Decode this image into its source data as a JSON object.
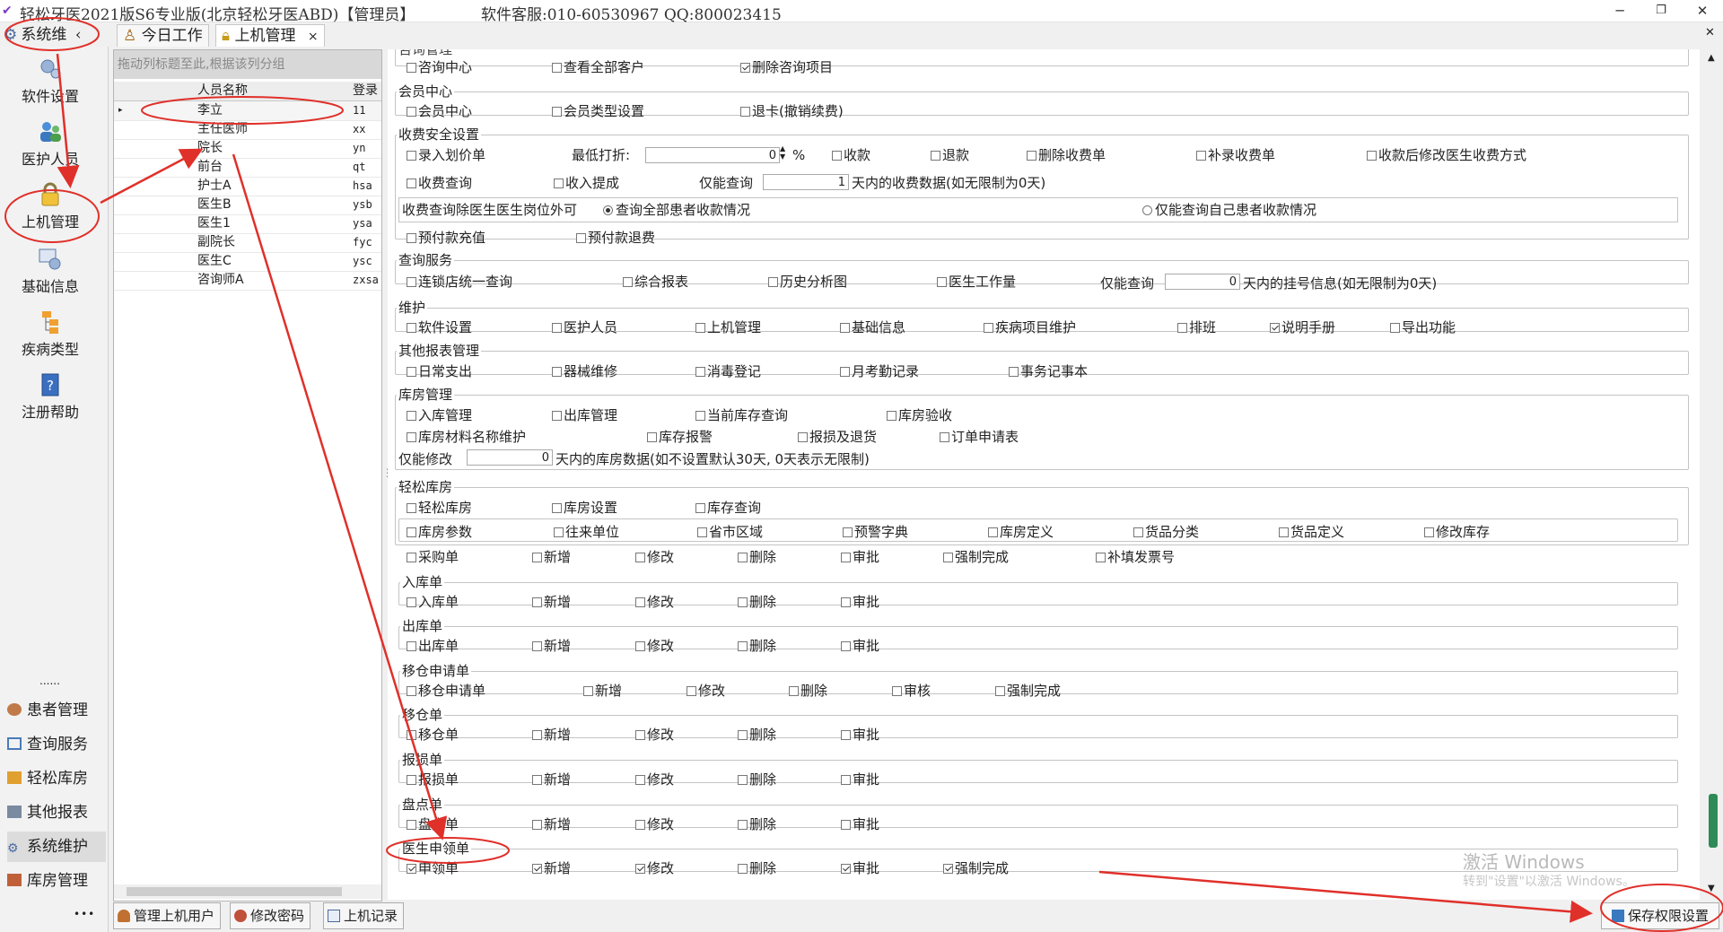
{
  "title": {
    "app": "轻松牙医2021版S6专业版(北京轻松牙医ABD)【管理员】",
    "service": "软件客服:010-60530967 QQ:800023415"
  },
  "window_buttons": {
    "minimize": "─",
    "restore": "❐",
    "close": "✕"
  },
  "sidebar_header": "系统维",
  "tabs": [
    {
      "label": "今日工作"
    },
    {
      "label": "上机管理",
      "close": "×"
    }
  ],
  "left_nav": {
    "big_items": [
      {
        "label": "软件设置"
      },
      {
        "label": "医护人员"
      },
      {
        "label": "上机管理"
      },
      {
        "label": "基础信息"
      },
      {
        "label": "疾病类型"
      },
      {
        "label": "注册帮助"
      }
    ],
    "dots": "......",
    "small_items": [
      {
        "label": "患者管理"
      },
      {
        "label": "查询服务"
      },
      {
        "label": "轻松库房"
      },
      {
        "label": "其他报表"
      },
      {
        "label": "系统维护"
      },
      {
        "label": "库房管理"
      }
    ],
    "more": "•••"
  },
  "user_grid": {
    "group_hint": "拖动列标题至此,根据该列分组",
    "columns": [
      "人员名称",
      "登录"
    ],
    "rows": [
      {
        "name": "李立",
        "login": "11",
        "checked": true
      },
      {
        "name": "主任医师",
        "login": "xx",
        "checked": false
      },
      {
        "name": "院长",
        "login": "yn",
        "checked": false
      },
      {
        "name": "前台",
        "login": "qt",
        "checked": false
      },
      {
        "name": "护士A",
        "login": "hsa",
        "checked": false
      },
      {
        "name": "医生B",
        "login": "ysb",
        "checked": false
      },
      {
        "name": "医生1",
        "login": "ysa",
        "checked": false
      },
      {
        "name": "副院长",
        "login": "fyc",
        "checked": false
      },
      {
        "name": "医生C",
        "login": "ysc",
        "checked": false
      },
      {
        "name": "咨询师A",
        "login": "zxsa",
        "checked": false
      }
    ]
  },
  "bottom_buttons": {
    "manage_users": "管理上机用户",
    "change_password": "修改密码",
    "login_records": "上机记录",
    "save": "保存权限设置"
  },
  "watermark": {
    "line1": "激活 Windows",
    "line2": "转到\"设置\"以激活 Windows。"
  },
  "permissions": {
    "consult": {
      "title": "咨询管理",
      "items": [
        {
          "label": "咨询中心",
          "on": false
        },
        {
          "label": "查看全部客户",
          "on": false
        },
        {
          "label": "删除咨询项目",
          "on": true
        }
      ]
    },
    "member": {
      "title": "会员中心",
      "items": [
        {
          "label": "会员中心",
          "on": false
        },
        {
          "label": "会员类型设置",
          "on": false
        },
        {
          "label": "退卡(撤销续费)",
          "on": false
        }
      ]
    },
    "fee": {
      "title": "收费安全设置",
      "row1": [
        {
          "label": "录入划价单",
          "on": false
        }
      ],
      "min_discount_label": "最低打折:",
      "min_discount_value": "0",
      "percent": "%",
      "row1b": [
        {
          "label": "收款",
          "on": false
        },
        {
          "label": "退款",
          "on": false
        },
        {
          "label": "删除收费单",
          "on": false
        },
        {
          "label": "补录收费单",
          "on": false
        },
        {
          "label": "收款后修改医生收费方式",
          "on": false
        }
      ],
      "row2": [
        {
          "label": "收费查询",
          "on": false
        },
        {
          "label": "收入提成",
          "on": false
        }
      ],
      "only_query": "仅能查询",
      "days_value": "1",
      "days_suffix": "天内的收费数据(如无限制为0天)",
      "role_label": "收费查询除医生医生岗位外可",
      "radio_all": "查询全部患者收款情况",
      "radio_self": "仅能查询自己患者收款情况",
      "row4": [
        {
          "label": "预付款充值",
          "on": false
        },
        {
          "label": "预付款退费",
          "on": false
        }
      ]
    },
    "query": {
      "title": "查询服务",
      "items": [
        {
          "label": "连锁店统一查询",
          "on": false
        },
        {
          "label": "综合报表",
          "on": false
        },
        {
          "label": "历史分析图",
          "on": false
        },
        {
          "label": "医生工作量",
          "on": false
        }
      ],
      "only_query": "仅能查询",
      "days_value": "0",
      "days_suffix": "天内的挂号信息(如无限制为0天)"
    },
    "maintain": {
      "title": "维护",
      "items": [
        {
          "label": "软件设置",
          "on": false
        },
        {
          "label": "医护人员",
          "on": false
        },
        {
          "label": "上机管理",
          "on": false
        },
        {
          "label": "基础信息",
          "on": false
        },
        {
          "label": "疾病项目维护",
          "on": false
        },
        {
          "label": "排班",
          "on": false
        },
        {
          "label": "说明手册",
          "on": true
        },
        {
          "label": "导出功能",
          "on": false
        }
      ]
    },
    "other_reports": {
      "title": "其他报表管理",
      "items": [
        {
          "label": "日常支出",
          "on": false
        },
        {
          "label": "器械维修",
          "on": false
        },
        {
          "label": "消毒登记",
          "on": false
        },
        {
          "label": "月考勤记录",
          "on": false
        },
        {
          "label": "事务记事本",
          "on": false
        }
      ]
    },
    "storehouse": {
      "title": "库房管理",
      "row1": [
        {
          "label": "入库管理",
          "on": false
        },
        {
          "label": "出库管理",
          "on": false
        },
        {
          "label": "当前库存查询",
          "on": false
        },
        {
          "label": "库房验收",
          "on": false
        }
      ],
      "row2": [
        {
          "label": "库房材料名称维护",
          "on": false
        },
        {
          "label": "库存报警",
          "on": false
        },
        {
          "label": "报损及退货",
          "on": false
        },
        {
          "label": "订单申请表",
          "on": false
        }
      ],
      "only_edit": "仅能修改",
      "days_value": "0",
      "days_suffix": "天内的库房数据(如不设置默认30天, 0天表示无限制)"
    },
    "easy_store": {
      "title": "轻松库房",
      "row1": [
        {
          "label": "轻松库房",
          "on": false
        },
        {
          "label": "库房设置",
          "on": false
        },
        {
          "label": "库存查询",
          "on": false
        }
      ],
      "row2": [
        {
          "label": "库房参数",
          "on": false
        },
        {
          "label": "往来单位",
          "on": false
        },
        {
          "label": "省市区域",
          "on": false
        },
        {
          "label": "预警字典",
          "on": false
        },
        {
          "label": "库房定义",
          "on": false
        },
        {
          "label": "货品分类",
          "on": false
        },
        {
          "label": "货品定义",
          "on": false
        },
        {
          "label": "修改库存",
          "on": false
        }
      ],
      "row3": [
        {
          "label": "采购单",
          "on": false
        },
        {
          "label": "新增",
          "on": false
        },
        {
          "label": "修改",
          "on": false
        },
        {
          "label": "删除",
          "on": false
        },
        {
          "label": "审批",
          "on": false
        },
        {
          "label": "强制完成",
          "on": false
        },
        {
          "label": "补填发票号",
          "on": false
        }
      ]
    },
    "inbound": {
      "title": "入库单",
      "items": [
        {
          "label": "入库单",
          "on": false
        },
        {
          "label": "新增",
          "on": false
        },
        {
          "label": "修改",
          "on": false
        },
        {
          "label": "删除",
          "on": false
        },
        {
          "label": "审批",
          "on": false
        }
      ]
    },
    "outbound": {
      "title": "出库单",
      "items": [
        {
          "label": "出库单",
          "on": false
        },
        {
          "label": "新增",
          "on": false
        },
        {
          "label": "修改",
          "on": false
        },
        {
          "label": "删除",
          "on": false
        },
        {
          "label": "审批",
          "on": false
        }
      ]
    },
    "transfer_req": {
      "title": "移仓申请单",
      "items": [
        {
          "label": "移仓申请单",
          "on": false
        },
        {
          "label": "新增",
          "on": false
        },
        {
          "label": "修改",
          "on": false
        },
        {
          "label": "删除",
          "on": false
        },
        {
          "label": "审核",
          "on": false
        },
        {
          "label": "强制完成",
          "on": false
        }
      ]
    },
    "transfer": {
      "title": "移仓单",
      "items": [
        {
          "label": "移仓单",
          "on": false
        },
        {
          "label": "新增",
          "on": false
        },
        {
          "label": "修改",
          "on": false
        },
        {
          "label": "删除",
          "on": false
        },
        {
          "label": "审批",
          "on": false
        }
      ]
    },
    "loss": {
      "title": "报损单",
      "items": [
        {
          "label": "报损单",
          "on": false
        },
        {
          "label": "新增",
          "on": false
        },
        {
          "label": "修改",
          "on": false
        },
        {
          "label": "删除",
          "on": false
        },
        {
          "label": "审批",
          "on": false
        }
      ]
    },
    "stocktake": {
      "title": "盘点单",
      "items": [
        {
          "label": "盘点单",
          "on": false
        },
        {
          "label": "新增",
          "on": false
        },
        {
          "label": "修改",
          "on": false
        },
        {
          "label": "删除",
          "on": false
        },
        {
          "label": "审批",
          "on": false
        }
      ]
    },
    "doctor_req": {
      "title": "医生申领单",
      "items": [
        {
          "label": "申领单",
          "on": true
        },
        {
          "label": "新增",
          "on": true
        },
        {
          "label": "修改",
          "on": true
        },
        {
          "label": "删除",
          "on": false
        },
        {
          "label": "审批",
          "on": true
        },
        {
          "label": "强制完成",
          "on": true
        }
      ]
    }
  }
}
